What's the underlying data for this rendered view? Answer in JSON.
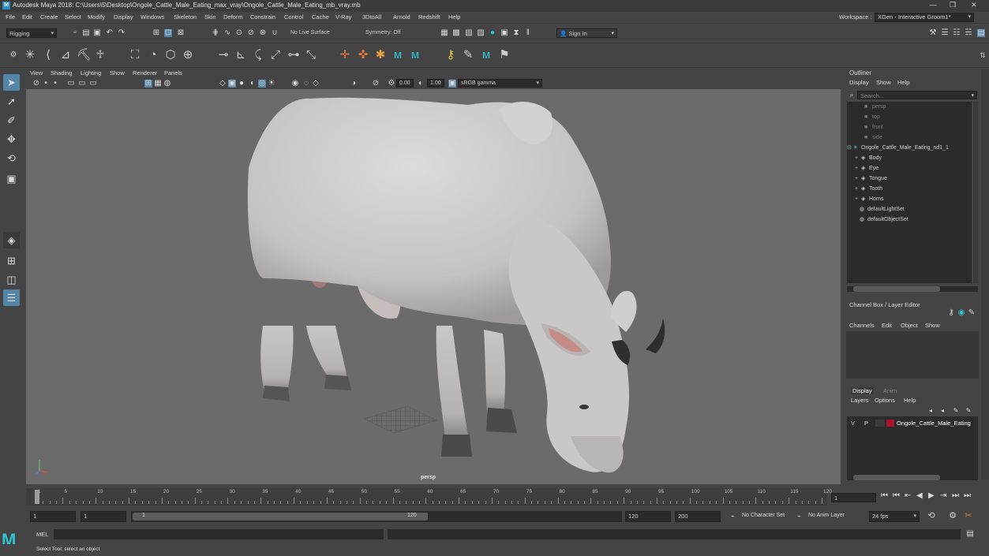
{
  "window": {
    "title": "Autodesk Maya 2018: C:\\Users\\5\\Desktop\\Ongole_Cattle_Male_Eating_max_vray\\Ongole_Cattle_Male_Eating_mb_vray.mb",
    "controls": [
      "—",
      "❐",
      "✕"
    ]
  },
  "menubar": {
    "items": [
      "File",
      "Edit",
      "Create",
      "Select",
      "Modify",
      "Display",
      "Windows",
      "Skeleton",
      "Skin",
      "Deform",
      "Constrain",
      "Control",
      "Cache",
      "V-Ray",
      "3DtoAll",
      "Arnold",
      "Redshift",
      "Help"
    ],
    "workspace_label": "Workspace :",
    "workspace_value": "XGen - Interactive Groom1*"
  },
  "statusline": {
    "mode": "Rigging",
    "live_surface": "No Live Surface",
    "symmetry": "Symmetry: Off",
    "sign_in": "Sign In"
  },
  "viewport": {
    "menu": [
      "View",
      "Shading",
      "Lighting",
      "Show",
      "Renderer",
      "Panels"
    ],
    "exposure": "0.00",
    "gamma": "1.00",
    "color_space": "sRGB gamma",
    "camera_label": "persp"
  },
  "outliner": {
    "title": "Outliner",
    "menu": [
      "Display",
      "Show",
      "Help"
    ],
    "search_placeholder": "Search...",
    "items": [
      {
        "label": "persp",
        "icon": "camera-icon",
        "dim": true
      },
      {
        "label": "top",
        "icon": "camera-icon",
        "dim": true
      },
      {
        "label": "front",
        "icon": "camera-icon",
        "dim": true
      },
      {
        "label": "side",
        "icon": "camera-icon",
        "dim": true
      },
      {
        "label": "Ongole_Cattle_Male_Eating_nd1_1",
        "icon": "transform-icon",
        "dim": false
      },
      {
        "label": "Body",
        "icon": "mesh-icon",
        "dim": false
      },
      {
        "label": "Eye",
        "icon": "mesh-icon",
        "dim": false
      },
      {
        "label": "Tongue",
        "icon": "mesh-icon",
        "dim": false
      },
      {
        "label": "Tooth",
        "icon": "mesh-icon",
        "dim": false
      },
      {
        "label": "Horns",
        "icon": "mesh-icon",
        "dim": false
      },
      {
        "label": "defaultLightSet",
        "icon": "set-icon",
        "dim": false
      },
      {
        "label": "defaultObjectSet",
        "icon": "set-icon",
        "dim": false
      }
    ]
  },
  "channel_box": {
    "title": "Channel Box / Layer Editor",
    "menu": [
      "Channels",
      "Edit",
      "Object",
      "Show"
    ]
  },
  "layer_editor": {
    "tabs": [
      "Display",
      "Anim"
    ],
    "menu": [
      "Layers",
      "Options",
      "Help"
    ],
    "layer": {
      "v": "V",
      "p": "P",
      "name": "Ongole_Cattle_Male_Eating",
      "color": "#b01030"
    }
  },
  "timeline": {
    "ticks": [
      "1",
      "5",
      "10",
      "15",
      "20",
      "25",
      "30",
      "35",
      "40",
      "45",
      "50",
      "55",
      "60",
      "65",
      "70",
      "75",
      "80",
      "85",
      "90",
      "95",
      "100",
      "105",
      "110",
      "115",
      "120"
    ],
    "current_frame": "1"
  },
  "range": {
    "start": "1",
    "playback_start": "1",
    "slider_start": "1",
    "slider_end": "120",
    "playback_end": "120",
    "end": "200",
    "character_set": "No Character Set",
    "anim_layer": "No Anim Layer",
    "fps": "24 fps"
  },
  "command": {
    "lang": "MEL"
  },
  "help": {
    "text": "Select Tool: select an object"
  },
  "colors": {
    "accent": "#5285a6",
    "viewport_bg": "#6b6b6b",
    "panel_bg": "#444444",
    "field_bg": "#2b2b2b"
  }
}
